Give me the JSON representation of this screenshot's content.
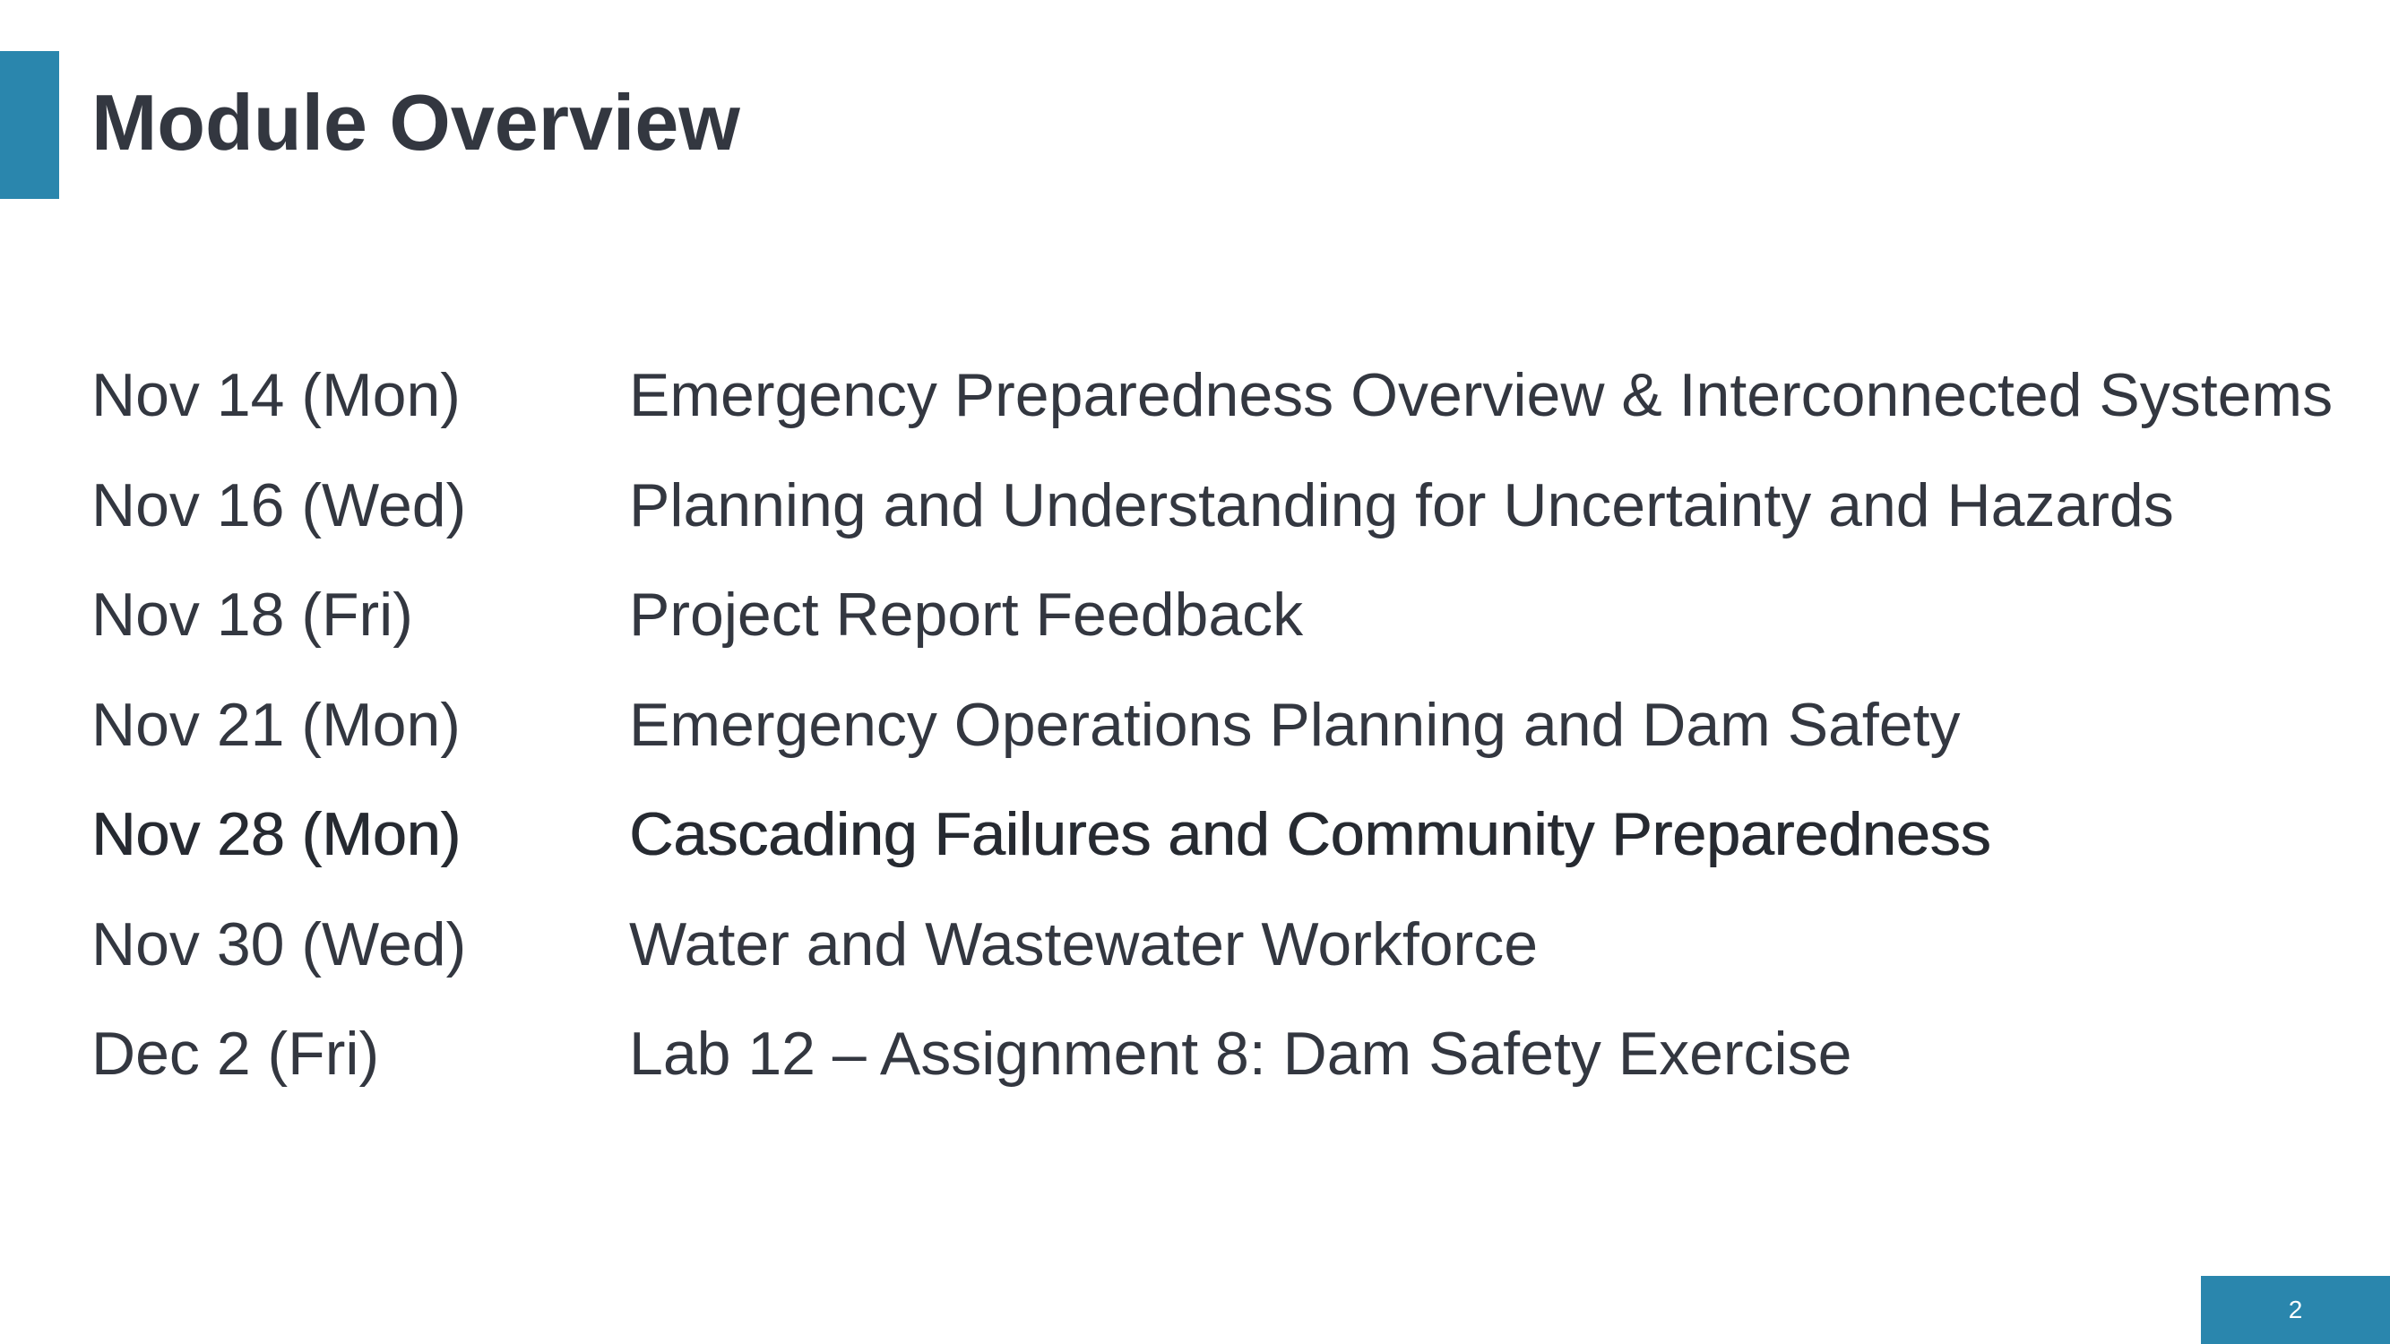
{
  "slide": {
    "title": "Module Overview",
    "page_number": "2",
    "accent_color": "#2a86ad",
    "text_color": "#333740"
  },
  "schedule": [
    {
      "date": "Nov 14 (Mon)",
      "topic": "Emergency Preparedness Overview & Interconnected Systems",
      "current": false
    },
    {
      "date": "Nov 16 (Wed)",
      "topic": "Planning and Understanding for Uncertainty and Hazards",
      "current": false
    },
    {
      "date": "Nov 18 (Fri)",
      "topic": "Project Report Feedback",
      "current": false
    },
    {
      "date": "Nov 21 (Mon)",
      "topic": "Emergency Operations Planning and Dam Safety",
      "current": false
    },
    {
      "date": "Nov 28 (Mon)",
      "topic": "Cascading Failures and Community Preparedness",
      "current": true
    },
    {
      "date": "Nov 30 (Wed)",
      "topic": "Water and Wastewater Workforce",
      "current": false
    },
    {
      "date": "Dec 2 (Fri)",
      "topic": "Lab 12 – Assignment 8: Dam Safety Exercise",
      "current": false
    }
  ]
}
